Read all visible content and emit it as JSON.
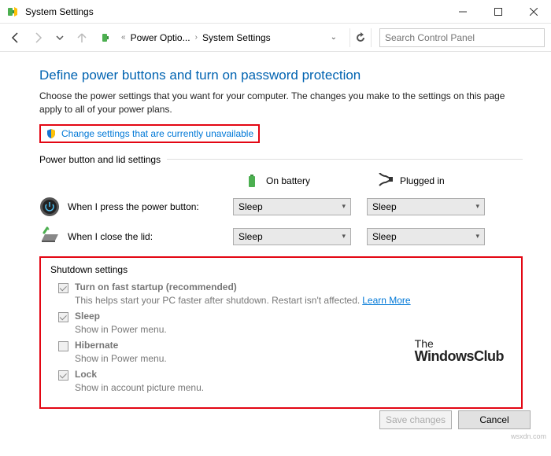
{
  "window": {
    "title": "System Settings"
  },
  "breadcrumb": {
    "item1": "Power Optio...",
    "item2": "System Settings"
  },
  "search": {
    "placeholder": "Search Control Panel"
  },
  "heading": "Define power buttons and turn on password protection",
  "description": "Choose the power settings that you want for your computer. The changes you make to the settings on this page apply to all of your power plans.",
  "change_link": "Change settings that are currently unavailable",
  "section_power": "Power button and lid settings",
  "col_battery": "On battery",
  "col_plugged": "Plugged in",
  "row_power_btn": {
    "label": "When I press the power button:",
    "battery": "Sleep",
    "plugged": "Sleep"
  },
  "row_lid": {
    "label": "When I close the lid:",
    "battery": "Sleep",
    "plugged": "Sleep"
  },
  "section_shutdown": "Shutdown settings",
  "shutdown": {
    "fast": {
      "label": "Turn on fast startup (recommended)",
      "sub": "This helps start your PC faster after shutdown. Restart isn't affected.",
      "learn": "Learn More"
    },
    "sleep": {
      "label": "Sleep",
      "sub": "Show in Power menu."
    },
    "hibernate": {
      "label": "Hibernate",
      "sub": "Show in Power menu."
    },
    "lock": {
      "label": "Lock",
      "sub": "Show in account picture menu."
    }
  },
  "watermark": {
    "l1": "The",
    "l2": "WindowsClub"
  },
  "buttons": {
    "save": "Save changes",
    "cancel": "Cancel"
  },
  "attribution": "wsxdn.com"
}
